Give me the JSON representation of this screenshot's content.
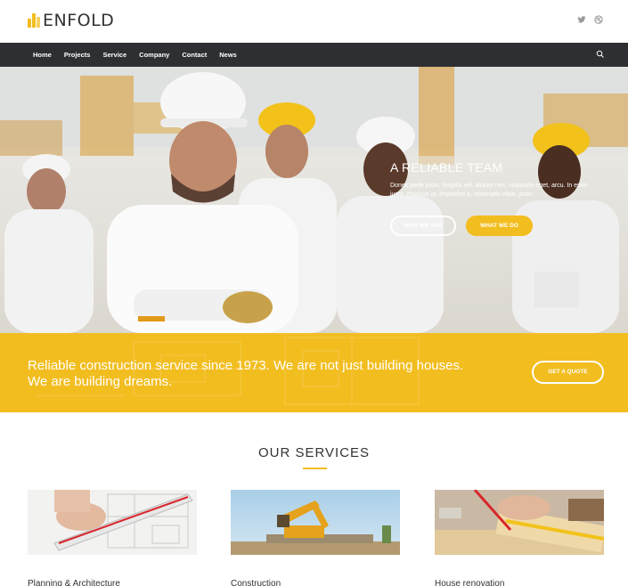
{
  "header": {
    "logo_text": "ENFOLD",
    "social_icons": [
      "twitter-icon",
      "dribbble-icon"
    ]
  },
  "nav": {
    "items": [
      "Home",
      "Projects",
      "Service",
      "Company",
      "Contact",
      "News"
    ],
    "search_icon": "search-icon"
  },
  "hero": {
    "title": "A RELIABLE TEAM",
    "text": "Donec pede justo, fringilla vel, aliquet nec, vulputate eget, arcu. In enim justo, rhoncus ut, imperdiet a, venenatis vitae, justo.",
    "button_primary": "WHO WE ARE",
    "button_secondary": "WHAT WE DO"
  },
  "banner": {
    "text": "Reliable construction service since 1973. We are not just building houses. We are building dreams.",
    "button": "GET A QUOTE"
  },
  "services": {
    "title": "OUR SERVICES",
    "items": [
      {
        "label": "Planning & Architecture"
      },
      {
        "label": "Construction"
      },
      {
        "label": "House renovation"
      }
    ]
  },
  "colors": {
    "accent": "#f2bd1f",
    "nav_bg": "#2d2f33",
    "text": "#333333"
  }
}
